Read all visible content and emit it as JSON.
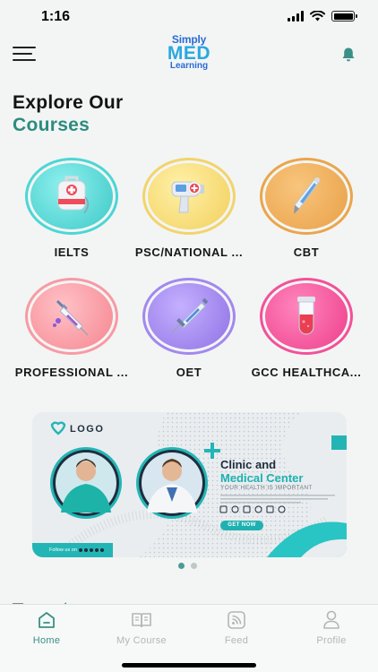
{
  "status_bar": {
    "time": "1:16"
  },
  "logo": {
    "line1": "Simply",
    "line2": "MED",
    "line3": "Learning"
  },
  "heading": {
    "line1": "Explore Our",
    "line2": "Courses"
  },
  "courses": [
    {
      "label": "IELTS",
      "icon": "first-aid-bag-icon",
      "color": "#4cd6d4"
    },
    {
      "label": "PSC/NATIONAL ...",
      "icon": "thermometer-gun-icon",
      "color": "#f3d36b"
    },
    {
      "label": "CBT",
      "icon": "thermometer-icon",
      "color": "#eba54a"
    },
    {
      "label": "PROFESSIONAL ...",
      "icon": "syringe-icon",
      "color": "#f89aa4"
    },
    {
      "label": "OET",
      "icon": "injection-icon",
      "color": "#a388ee"
    },
    {
      "label": "GCC HEALTHCA...",
      "icon": "test-tube-icon",
      "color": "#f4509a"
    }
  ],
  "banner": {
    "logo_text": "LOGO",
    "title_line1": "Clinic and",
    "title_line2": "Medical Center",
    "tagline": "YOUR HEALTH IS IMPORTANT",
    "cta": "GET NOW",
    "follow": "Follow us on"
  },
  "carousel": {
    "slide_count": 2,
    "active_index": 0
  },
  "tabs": [
    {
      "label": "Home",
      "icon": "home-icon",
      "active": true
    },
    {
      "label": "My Course",
      "icon": "book-icon",
      "active": false
    },
    {
      "label": "Feed",
      "icon": "rss-icon",
      "active": false
    },
    {
      "label": "Profile",
      "icon": "person-icon",
      "active": false
    }
  ],
  "colors": {
    "accent": "#3a8f86",
    "teal_heading": "#2c8c80",
    "background": "#f2f5f4"
  }
}
